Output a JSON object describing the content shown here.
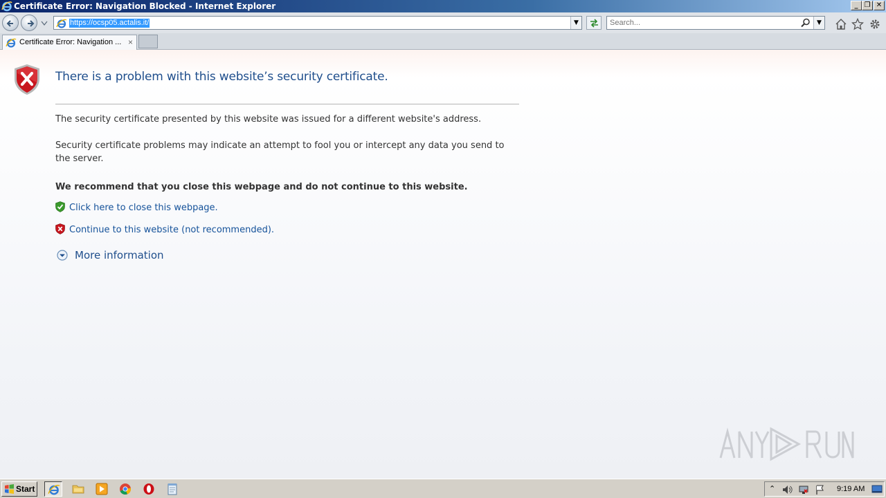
{
  "window": {
    "title": "Certificate Error: Navigation Blocked - Internet Explorer",
    "minimize_glyph": "_",
    "restore_glyph": "❐",
    "close_glyph": "✕"
  },
  "navbar": {
    "url": "https://ocsp05.actalis.it/",
    "search_placeholder": "Search..."
  },
  "tabs": [
    {
      "label": "Certificate Error: Navigation ...",
      "close": "×"
    }
  ],
  "page": {
    "heading": "There is a problem with this website’s security certificate.",
    "p1": "The security certificate presented by this website was issued for a different website's address.",
    "p2": "Security certificate problems may indicate an attempt to fool you or intercept any data you send to the server.",
    "recommend": "We recommend that you close this webpage and do not continue to this website.",
    "close_link": "Click here to close this webpage.",
    "continue_link": "Continue to this website (not recommended).",
    "more_info": "More information"
  },
  "taskbar": {
    "start_label": "Start",
    "clock": "9:19 AM"
  },
  "colors": {
    "link": "#15529a",
    "heading": "#1f4e8c",
    "shield_red": "#c8161e",
    "shield_green": "#3a9a2c"
  },
  "icons": [
    "ie-logo-icon",
    "back-icon",
    "forward-icon",
    "refresh-icon",
    "search-icon",
    "home-icon",
    "favorites-star-icon",
    "tools-gear-icon",
    "shield-error-icon",
    "shield-ok-icon",
    "expand-arrow-icon"
  ]
}
